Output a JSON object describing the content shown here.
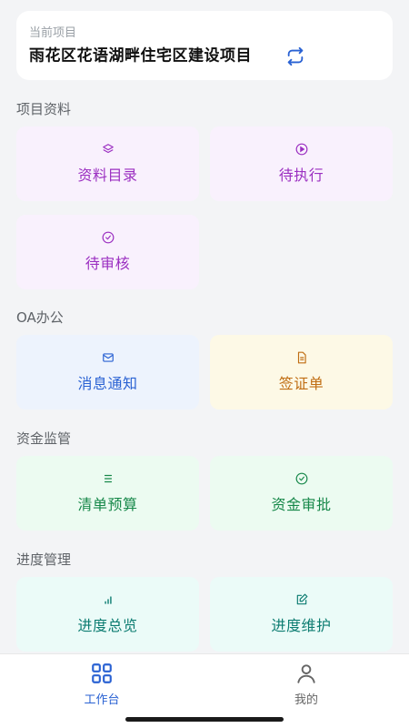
{
  "project": {
    "label": "当前项目",
    "name": "雨花区花语湖畔住宅区建设项目",
    "swap_icon": "swap-arrows-icon"
  },
  "sections": [
    {
      "title": "项目资料",
      "tiles": [
        {
          "label": "资料目录",
          "icon": "layers-icon",
          "color": "#9b2fc1"
        },
        {
          "label": "待执行",
          "icon": "play-circle-icon",
          "color": "#9b2fc1"
        },
        {
          "label": "待审核",
          "icon": "check-circle-icon",
          "color": "#9b2fc1"
        }
      ]
    },
    {
      "title": "OA办公",
      "tiles": [
        {
          "label": "消息通知",
          "icon": "mail-icon",
          "color": "#2a62d3"
        },
        {
          "label": "签证单",
          "icon": "document-icon",
          "color": "#c06d12"
        }
      ]
    },
    {
      "title": "资金监管",
      "tiles": [
        {
          "label": "清单预算",
          "icon": "list-icon",
          "color": "#17884a"
        },
        {
          "label": "资金审批",
          "icon": "check-circle-icon",
          "color": "#17884a"
        }
      ]
    },
    {
      "title": "进度管理",
      "tiles": [
        {
          "label": "进度总览",
          "icon": "bar-chart-icon",
          "color": "#0c7c71"
        },
        {
          "label": "进度维护",
          "icon": "edit-icon",
          "color": "#0c7c71"
        }
      ]
    }
  ],
  "tabbar": {
    "items": [
      {
        "label": "工作台",
        "icon": "grid-icon",
        "active": true
      },
      {
        "label": "我的",
        "icon": "user-icon",
        "active": false
      }
    ],
    "active_color": "#2a62d3",
    "inactive_color": "#666666"
  }
}
